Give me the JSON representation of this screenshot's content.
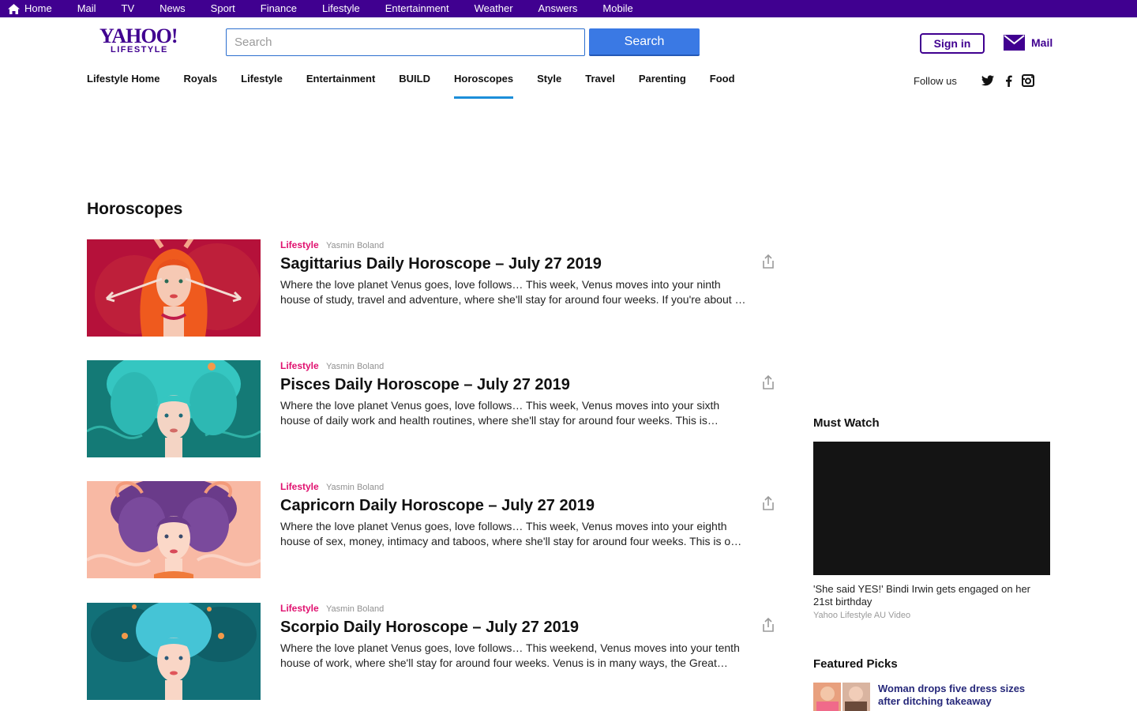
{
  "topbar": {
    "items": [
      "Home",
      "Mail",
      "TV",
      "News",
      "Sport",
      "Finance",
      "Lifestyle",
      "Entertainment",
      "Weather",
      "Answers",
      "Mobile"
    ],
    "bg_color": "#400090"
  },
  "header": {
    "logo_main": "YAHOO!",
    "logo_sub": "LIFESTYLE",
    "search_placeholder": "Search",
    "search_button": "Search",
    "sign_in": "Sign in",
    "mail": "Mail"
  },
  "subnav": {
    "items": [
      "Lifestyle Home",
      "Royals",
      "Lifestyle",
      "Entertainment",
      "BUILD",
      "Horoscopes",
      "Style",
      "Travel",
      "Parenting",
      "Food"
    ],
    "active": "Horoscopes",
    "follow_label": "Follow us",
    "social_icons": [
      "twitter-icon",
      "facebook-icon",
      "instagram-icon"
    ]
  },
  "main": {
    "section_title": "Horoscopes",
    "articles": [
      {
        "category": "Lifestyle",
        "author": "Yasmin Boland",
        "title": "Sagittarius Daily Horoscope – July 27 2019",
        "summary": "Where the love planet Venus goes, love follows… This week, Venus moves into your ninth house of study, travel and adventure, where she'll stay for around four weeks. If you're about …"
      },
      {
        "category": "Lifestyle",
        "author": "Yasmin Boland",
        "title": "Pisces Daily Horoscope – July 27 2019",
        "summary": "Where the love planet Venus goes, love follows… This week, Venus moves into your sixth house of daily work and health routines, where she'll stay for around four weeks. This is…"
      },
      {
        "category": "Lifestyle",
        "author": "Yasmin Boland",
        "title": "Capricorn Daily Horoscope – July 27 2019",
        "summary": "Where the love planet Venus goes, love follows… This week, Venus moves into your eighth house of sex, money, intimacy and taboos, where she'll stay for around four weeks. This is o…"
      },
      {
        "category": "Lifestyle",
        "author": "Yasmin Boland",
        "title": "Scorpio Daily Horoscope – July 27 2019",
        "summary": "Where the love planet Venus goes, love follows… This weekend, Venus moves into your tenth house of work, where she'll stay for around four weeks. Venus is in many ways, the Great…"
      }
    ]
  },
  "sidebar": {
    "must_watch": {
      "heading": "Must Watch",
      "video_title": "'She said YES!' Bindi Irwin gets engaged on her 21st birthday",
      "video_source": "Yahoo Lifestyle AU Video"
    },
    "featured": {
      "heading": "Featured Picks",
      "pick_title": "Woman drops five dress sizes after ditching takeaway"
    }
  },
  "colors": {
    "brand_purple": "#400090",
    "search_blue": "#3a79e4",
    "category_pink": "#e0116f",
    "active_underline": "#1c8ed9"
  }
}
